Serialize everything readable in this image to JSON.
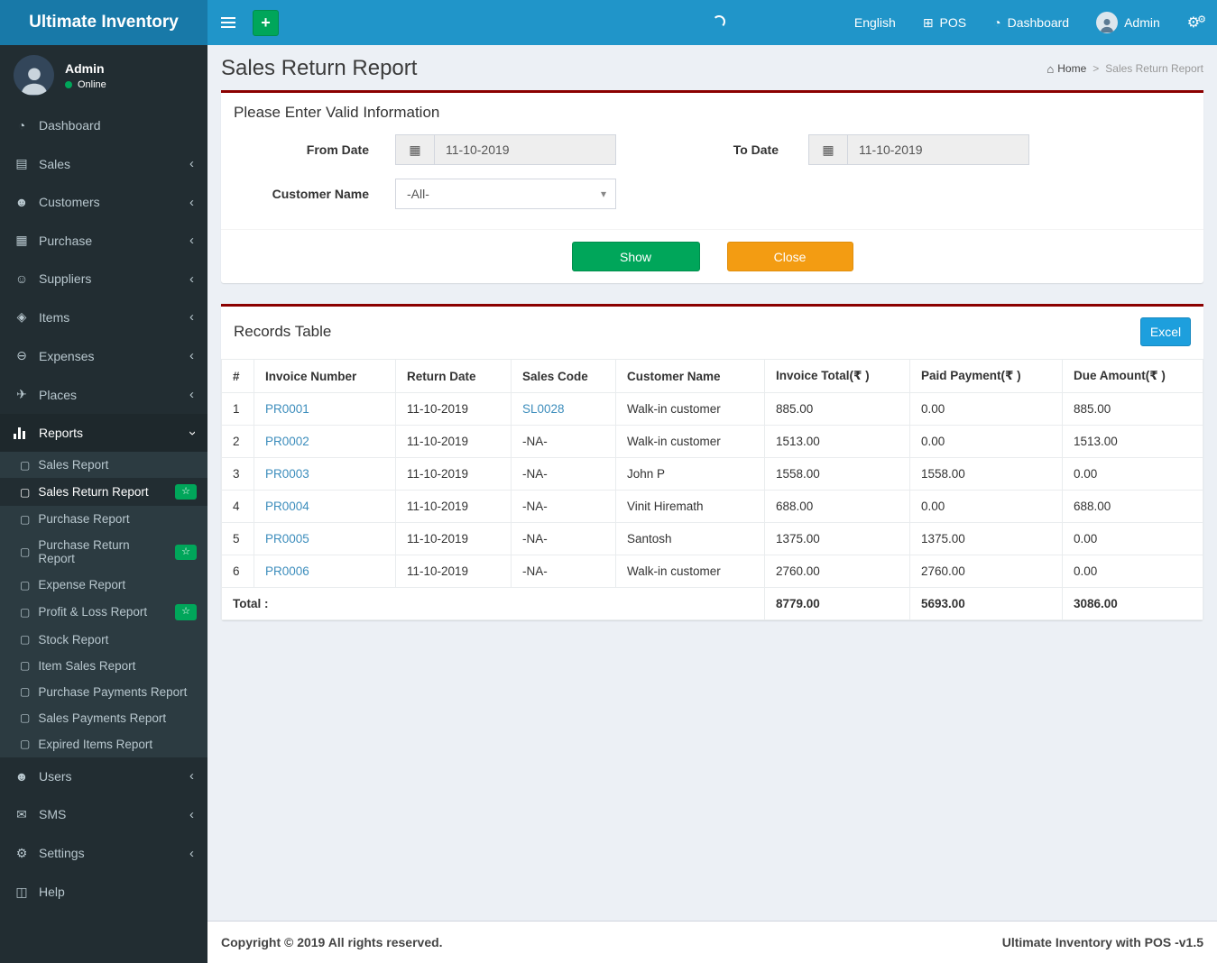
{
  "colors": {
    "navbar_blue": "#2095c9",
    "logo_blue": "#1879a8",
    "sidebar_dark": "#222d32",
    "panel_top_border": "#8b0000",
    "success_green": "#00a65a",
    "warning_orange": "#f39c12",
    "info_blue": "#1d9fdd",
    "link_blue": "#3c8dbc"
  },
  "navbar": {
    "brand": "Ultimate Inventory",
    "language": "English",
    "pos_label": "POS",
    "dashboard_label": "Dashboard",
    "user_label": "Admin",
    "icons": [
      "hamburger-icon",
      "plus-icon",
      "loading-spinner",
      "pos-grid-icon",
      "dashboard-gauge-icon",
      "user-avatar",
      "gears-icon"
    ]
  },
  "sidebar": {
    "user_name": "Admin",
    "user_status": "Online",
    "items": [
      {
        "label": "Dashboard",
        "icon": "gauge-icon"
      },
      {
        "label": "Sales",
        "icon": "monitor-icon"
      },
      {
        "label": "Customers",
        "icon": "users-icon"
      },
      {
        "label": "Purchase",
        "icon": "grid-icon"
      },
      {
        "label": "Suppliers",
        "icon": "user-plus-icon"
      },
      {
        "label": "Items",
        "icon": "items-icon"
      },
      {
        "label": "Expenses",
        "icon": "minus-circle-icon"
      },
      {
        "label": "Places",
        "icon": "paper-plane-icon"
      },
      {
        "label": "Reports",
        "icon": "bar-chart-icon"
      },
      {
        "label": "Users",
        "icon": "users-icon"
      },
      {
        "label": "SMS",
        "icon": "message-icon"
      },
      {
        "label": "Settings",
        "icon": "gear-icon"
      },
      {
        "label": "Help",
        "icon": "book-icon"
      }
    ],
    "reports_submenu": [
      {
        "label": "Sales Report"
      },
      {
        "label": "Sales Return Report",
        "badge": "star",
        "active": true
      },
      {
        "label": "Purchase Report"
      },
      {
        "label": "Purchase Return Report",
        "badge": "star"
      },
      {
        "label": "Expense Report"
      },
      {
        "label": "Profit & Loss Report",
        "badge": "star"
      },
      {
        "label": "Stock Report"
      },
      {
        "label": "Item Sales Report"
      },
      {
        "label": "Purchase Payments Report"
      },
      {
        "label": "Sales Payments Report"
      },
      {
        "label": "Expired Items Report"
      }
    ]
  },
  "page": {
    "title": "Sales Return Report",
    "breadcrumb_home": "Home",
    "breadcrumb_current": "Sales Return Report"
  },
  "filter": {
    "heading": "Please Enter Valid Information",
    "from_date_label": "From Date",
    "from_date_value": "11-10-2019",
    "to_date_label": "To Date",
    "to_date_value": "11-10-2019",
    "customer_label": "Customer Name",
    "customer_value": "-All-",
    "show_button": "Show",
    "close_button": "Close"
  },
  "records": {
    "heading": "Records Table",
    "excel_button": "Excel",
    "columns": [
      "#",
      "Invoice Number",
      "Return Date",
      "Sales Code",
      "Customer Name",
      "Invoice Total(₹ )",
      "Paid Payment(₹ )",
      "Due Amount(₹ )"
    ],
    "rows": [
      {
        "sn": "1",
        "invoice": "PR0001",
        "return_date": "11-10-2019",
        "sales_code": "SL0028",
        "customer": "Walk-in customer",
        "invoice_total": "885.00",
        "paid": "0.00",
        "due": "885.00"
      },
      {
        "sn": "2",
        "invoice": "PR0002",
        "return_date": "11-10-2019",
        "sales_code": "-NA-",
        "customer": "Walk-in customer",
        "invoice_total": "1513.00",
        "paid": "0.00",
        "due": "1513.00"
      },
      {
        "sn": "3",
        "invoice": "PR0003",
        "return_date": "11-10-2019",
        "sales_code": "-NA-",
        "customer": "John P",
        "invoice_total": "1558.00",
        "paid": "1558.00",
        "due": "0.00"
      },
      {
        "sn": "4",
        "invoice": "PR0004",
        "return_date": "11-10-2019",
        "sales_code": "-NA-",
        "customer": "Vinit Hiremath",
        "invoice_total": "688.00",
        "paid": "0.00",
        "due": "688.00"
      },
      {
        "sn": "5",
        "invoice": "PR0005",
        "return_date": "11-10-2019",
        "sales_code": "-NA-",
        "customer": "Santosh",
        "invoice_total": "1375.00",
        "paid": "1375.00",
        "due": "0.00"
      },
      {
        "sn": "6",
        "invoice": "PR0006",
        "return_date": "11-10-2019",
        "sales_code": "-NA-",
        "customer": "Walk-in customer",
        "invoice_total": "2760.00",
        "paid": "2760.00",
        "due": "0.00"
      }
    ],
    "total_label": "Total :",
    "total_invoice": "8779.00",
    "total_paid": "5693.00",
    "total_due": "3086.00"
  },
  "footer": {
    "copyright": "Copyright © 2019 All rights reserved.",
    "version": "Ultimate Inventory with POS -v1.5"
  }
}
